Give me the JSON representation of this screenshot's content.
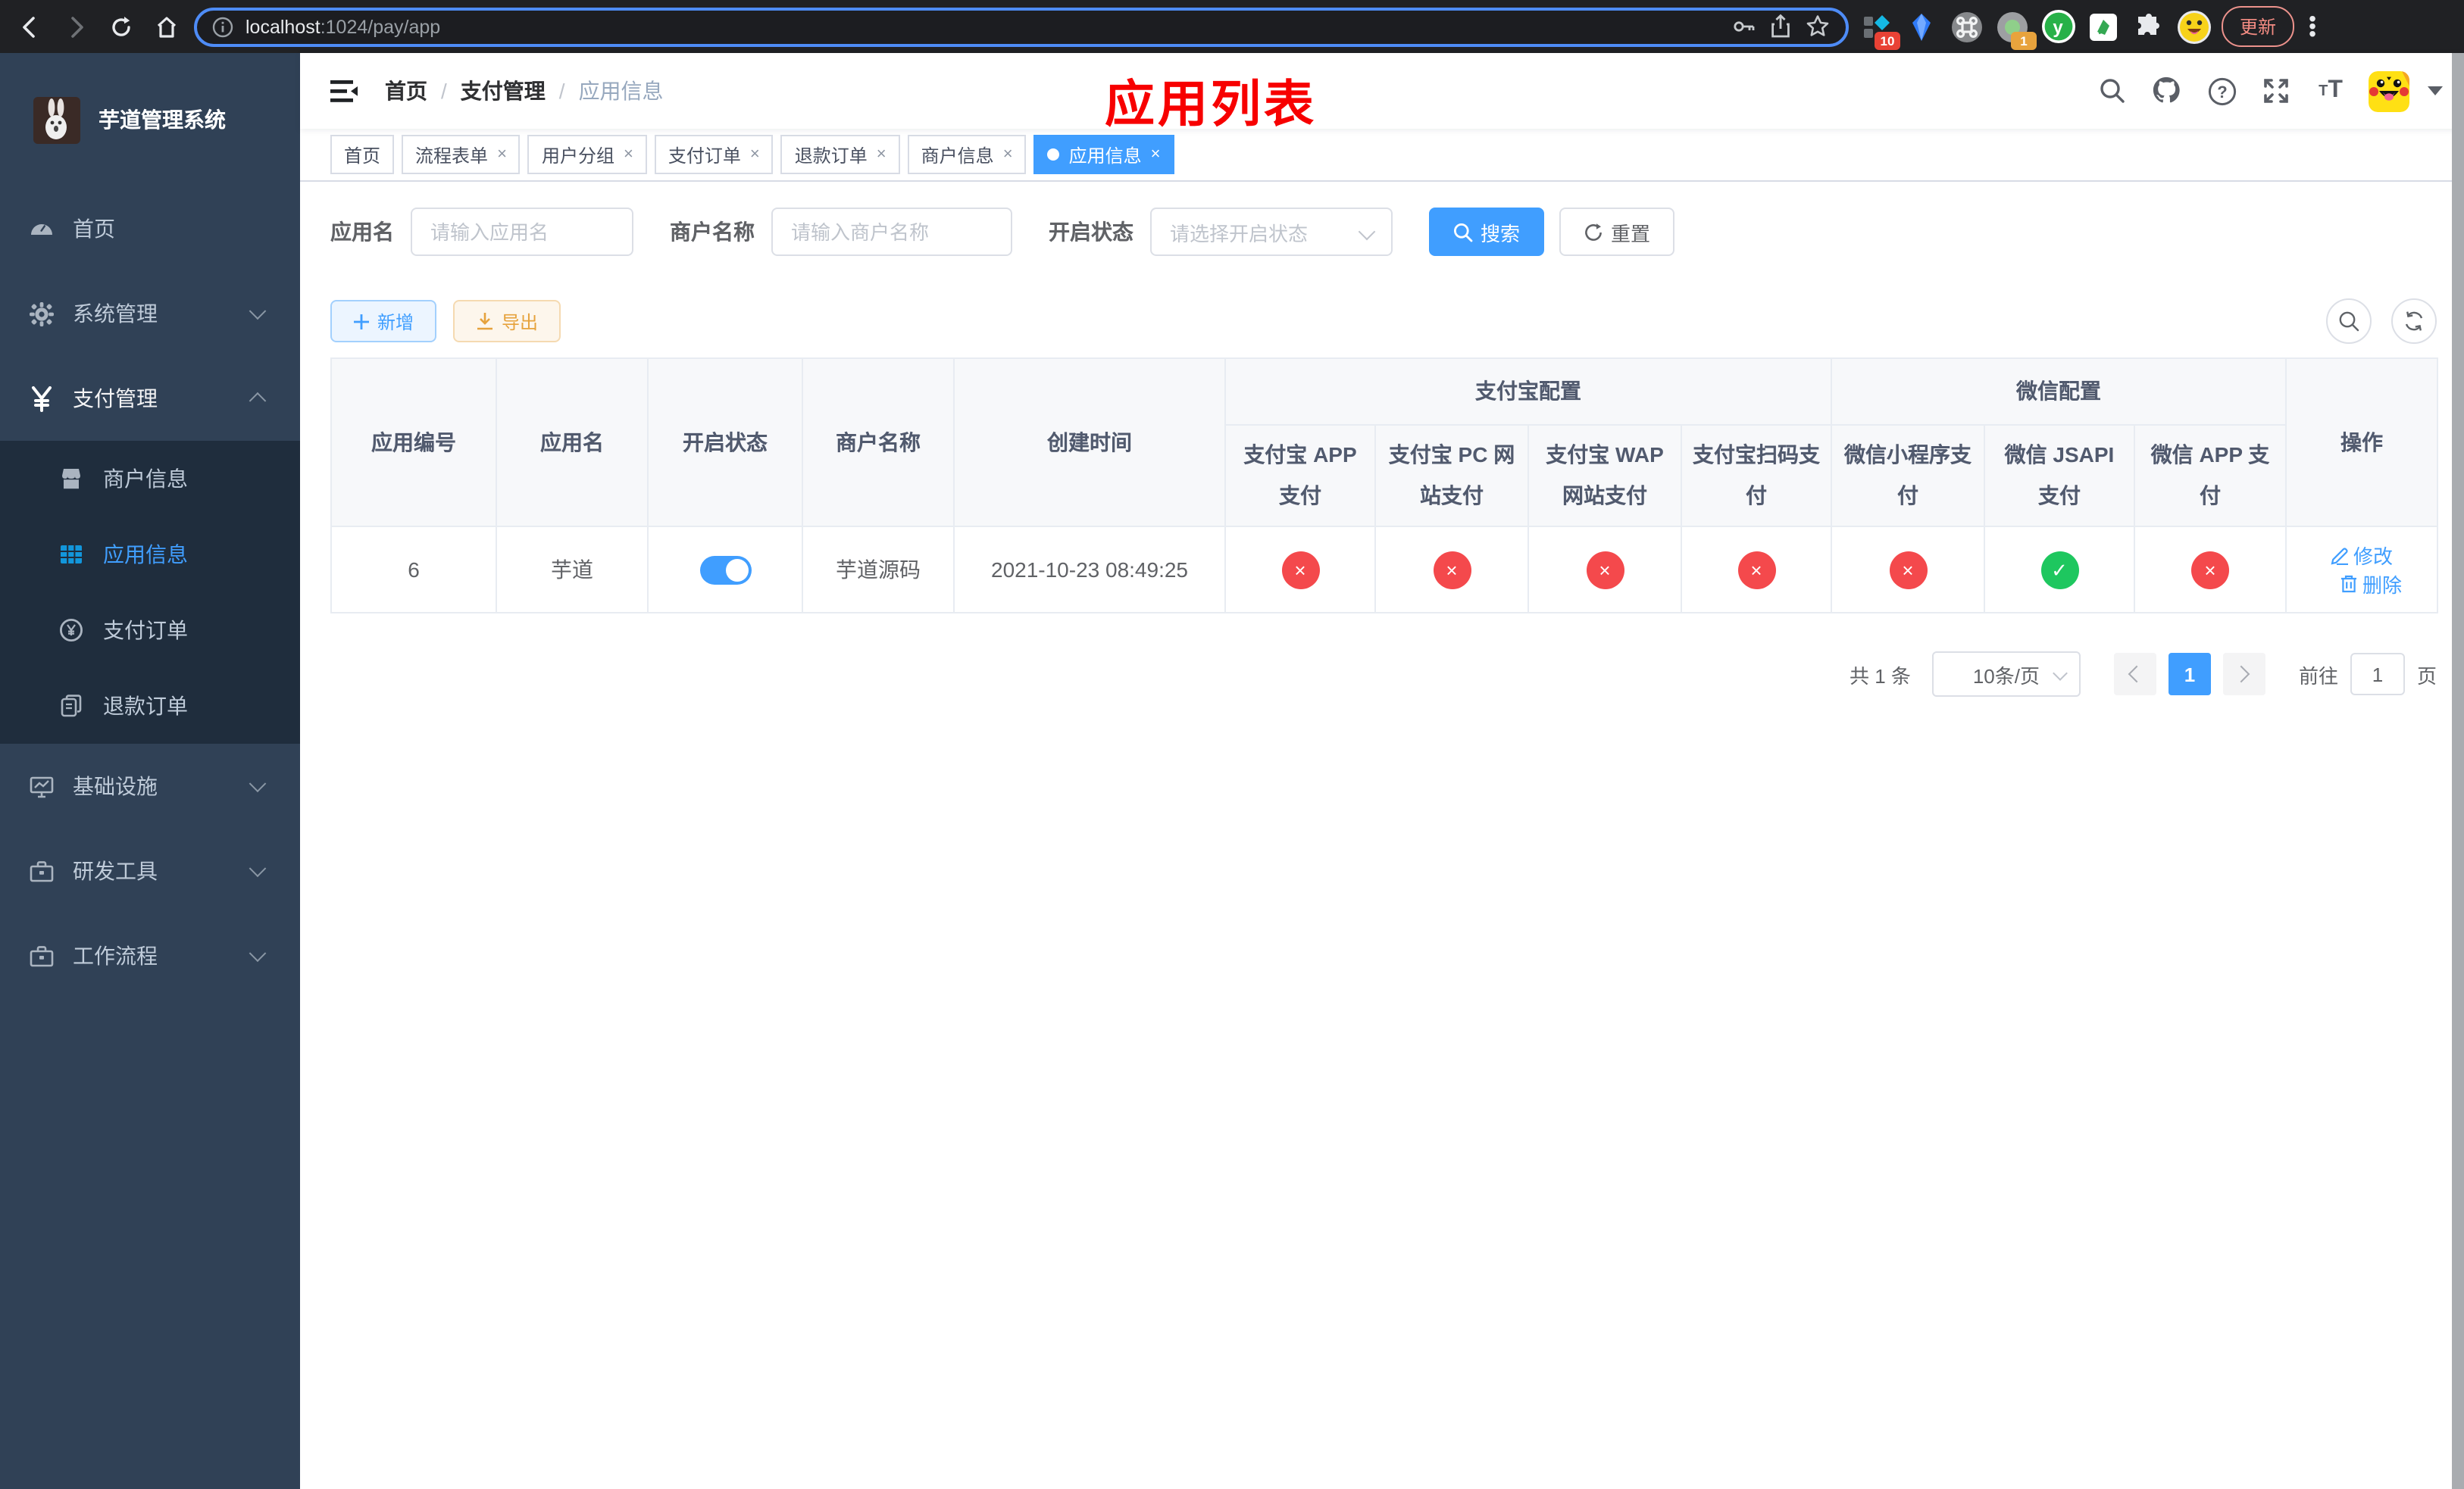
{
  "browser": {
    "url": {
      "host": "localhost",
      "path": ":1024/pay/app"
    },
    "update_button": "更新",
    "extension_badges": {
      "first": "10",
      "second": "1"
    },
    "extension_y_glyph": "y"
  },
  "sidebar": {
    "title": "芋道管理系统",
    "items": [
      {
        "label": "首页"
      },
      {
        "label": "系统管理"
      },
      {
        "label": "支付管理"
      },
      {
        "label": "基础设施"
      },
      {
        "label": "研发工具"
      },
      {
        "label": "工作流程"
      }
    ],
    "payment_children": [
      {
        "label": "商户信息"
      },
      {
        "label": "应用信息"
      },
      {
        "label": "支付订单"
      },
      {
        "label": "退款订单"
      }
    ]
  },
  "header": {
    "breadcrumb": [
      "首页",
      "支付管理",
      "应用信息"
    ],
    "separator": "/",
    "overlay_title": "应用列表",
    "help_glyph": "?",
    "font_icon_small": "T",
    "font_icon_large": "T"
  },
  "tabs": {
    "close_glyph": "×",
    "items": [
      {
        "label": "首页"
      },
      {
        "label": "流程表单"
      },
      {
        "label": "用户分组"
      },
      {
        "label": "支付订单"
      },
      {
        "label": "退款订单"
      },
      {
        "label": "商户信息"
      },
      {
        "label": "应用信息"
      }
    ]
  },
  "filters": {
    "app_name_label": "应用名",
    "app_name_placeholder": "请输入应用名",
    "merchant_label": "商户名称",
    "merchant_placeholder": "请输入商户名称",
    "status_label": "开启状态",
    "status_placeholder": "请选择开启状态",
    "search_label": "搜索",
    "reset_label": "重置"
  },
  "toolbar": {
    "add_label": "新增",
    "export_label": "导出"
  },
  "table": {
    "columns": {
      "app_id": "应用编号",
      "app_name": "应用名",
      "status": "开启状态",
      "merchant": "商户名称",
      "created": "创建时间",
      "ops": "操作",
      "alipay_group": "支付宝配置",
      "wechat_group": "微信配置",
      "sub": [
        "支付宝 APP 支付",
        "支付宝 PC 网站支付",
        "支付宝 WAP 网站支付",
        "支付宝扫码支付",
        "微信小程序支付",
        "微信 JSAPI 支付",
        "微信 APP 支付"
      ]
    },
    "row": {
      "id": "6",
      "name": "芋道",
      "enabled": true,
      "merchant": "芋道源码",
      "created": "2021-10-23 08:49:25",
      "statuses": [
        false,
        false,
        false,
        false,
        false,
        true,
        false
      ],
      "edit_label": "修改",
      "delete_label": "删除"
    }
  },
  "pagination": {
    "total": "共 1 条",
    "page_size": "10条/页",
    "page": "1",
    "goto": "前往",
    "goto_value": "1",
    "unit": "页"
  },
  "colors": {
    "accent": "#409eff",
    "success": "#1ec75f",
    "danger": "#f4494c",
    "sidebar_bg": "#304156",
    "submenu_bg": "#1f2d3d",
    "annotation_red": "#f70000"
  }
}
